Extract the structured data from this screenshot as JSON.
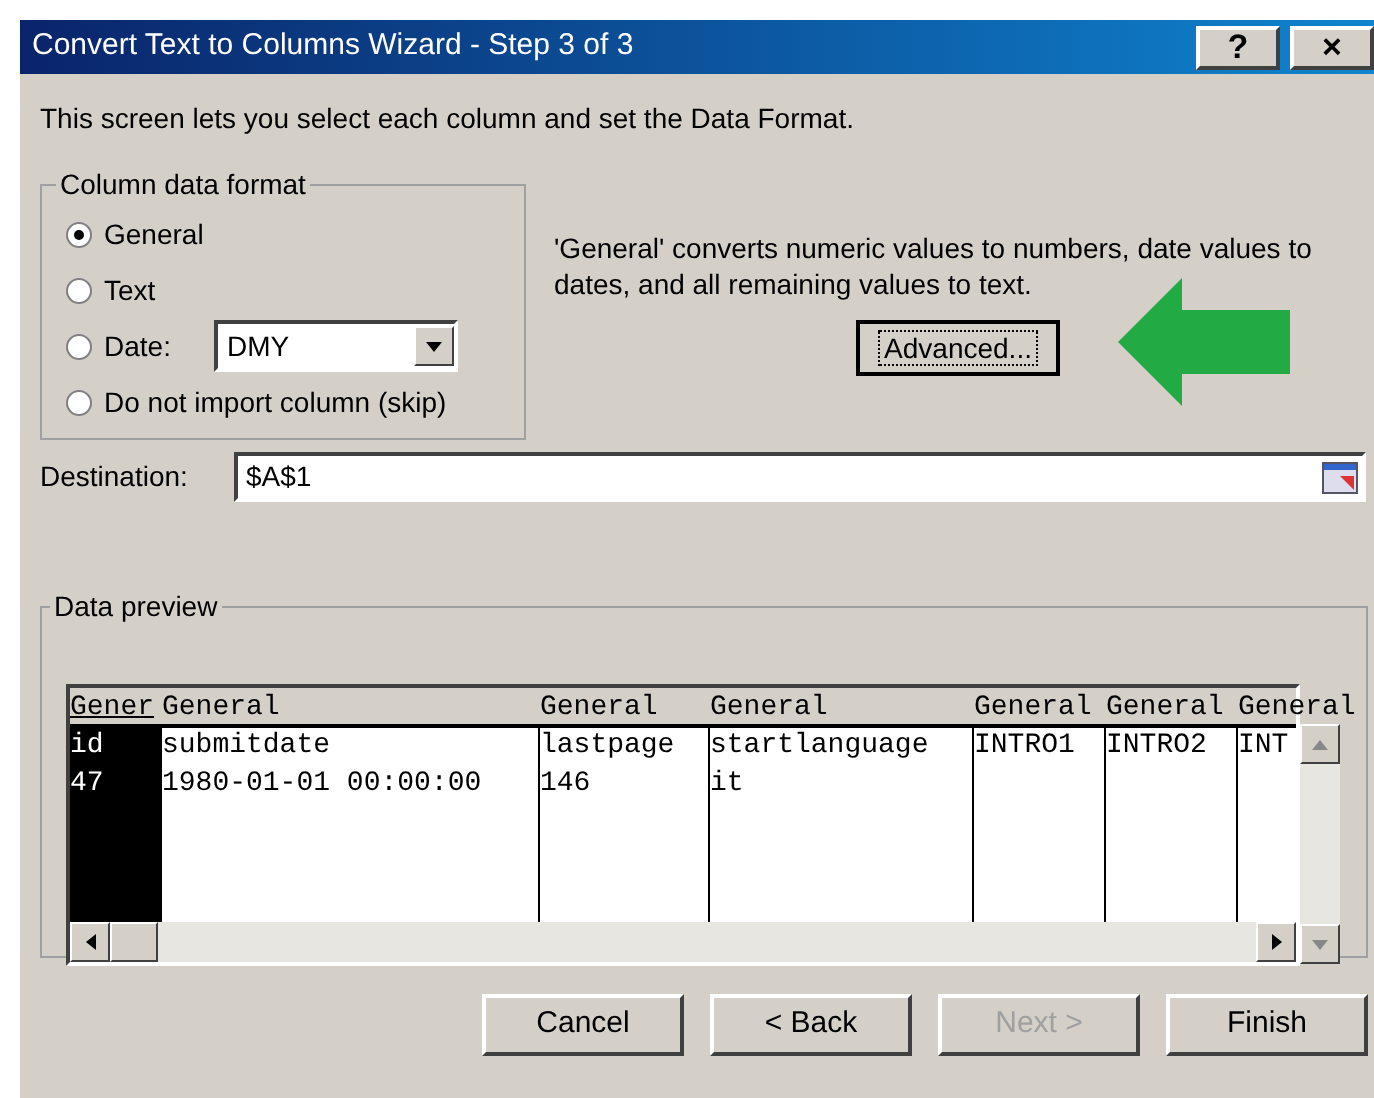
{
  "window": {
    "title": "Convert Text to Columns Wizard - Step 3 of 3",
    "controls": [
      "?",
      "×"
    ]
  },
  "intro": "This screen lets you select each column and set the Data Format.",
  "format_group": {
    "title": "Column data format",
    "options": [
      {
        "kind": "plain",
        "label": "General",
        "selected": true
      },
      {
        "kind": "plain",
        "label": "Text",
        "selected": false
      },
      {
        "kind": "date",
        "label": "Date:",
        "selected": false,
        "dropdown": "DMY"
      },
      {
        "kind": "plain",
        "label": "Do not import column (skip)",
        "selected": false
      }
    ]
  },
  "explanation": "'General' converts numeric values to numbers, date values to dates, and all remaining values to text.",
  "advanced_button": "Advanced...",
  "destination": {
    "label": "Destination:",
    "value": "$A$1"
  },
  "preview": {
    "title": "Data preview",
    "columns": [
      {
        "format": "Gener",
        "selected": true
      },
      {
        "format": "General",
        "selected": false
      },
      {
        "format": "General",
        "selected": false
      },
      {
        "format": "General",
        "selected": false
      },
      {
        "format": "General",
        "selected": false
      },
      {
        "format": "General",
        "selected": false
      },
      {
        "format": "General",
        "selected": false
      }
    ],
    "rows": [
      [
        "id",
        "submitdate",
        "lastpage",
        "startlanguage",
        "INTRO1",
        "INTRO2",
        "INT"
      ],
      [
        "47",
        "1980-01-01 00:00:00",
        "146",
        "it",
        "",
        "",
        ""
      ]
    ]
  },
  "buttons": [
    {
      "label": "Cancel",
      "disabled": false
    },
    {
      "label": "< Back",
      "disabled": false
    },
    {
      "label": "Next >",
      "disabled": true
    },
    {
      "label": "Finish",
      "disabled": false
    }
  ]
}
